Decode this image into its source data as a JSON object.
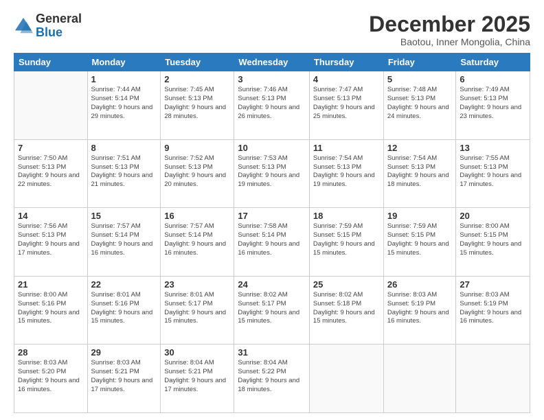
{
  "logo": {
    "general": "General",
    "blue": "Blue"
  },
  "header": {
    "month": "December 2025",
    "location": "Baotou, Inner Mongolia, China"
  },
  "days_of_week": [
    "Sunday",
    "Monday",
    "Tuesday",
    "Wednesday",
    "Thursday",
    "Friday",
    "Saturday"
  ],
  "weeks": [
    [
      {
        "day": "",
        "info": ""
      },
      {
        "day": "1",
        "info": "Sunrise: 7:44 AM\nSunset: 5:14 PM\nDaylight: 9 hours\nand 29 minutes."
      },
      {
        "day": "2",
        "info": "Sunrise: 7:45 AM\nSunset: 5:13 PM\nDaylight: 9 hours\nand 28 minutes."
      },
      {
        "day": "3",
        "info": "Sunrise: 7:46 AM\nSunset: 5:13 PM\nDaylight: 9 hours\nand 26 minutes."
      },
      {
        "day": "4",
        "info": "Sunrise: 7:47 AM\nSunset: 5:13 PM\nDaylight: 9 hours\nand 25 minutes."
      },
      {
        "day": "5",
        "info": "Sunrise: 7:48 AM\nSunset: 5:13 PM\nDaylight: 9 hours\nand 24 minutes."
      },
      {
        "day": "6",
        "info": "Sunrise: 7:49 AM\nSunset: 5:13 PM\nDaylight: 9 hours\nand 23 minutes."
      }
    ],
    [
      {
        "day": "7",
        "info": "Sunrise: 7:50 AM\nSunset: 5:13 PM\nDaylight: 9 hours\nand 22 minutes."
      },
      {
        "day": "8",
        "info": "Sunrise: 7:51 AM\nSunset: 5:13 PM\nDaylight: 9 hours\nand 21 minutes."
      },
      {
        "day": "9",
        "info": "Sunrise: 7:52 AM\nSunset: 5:13 PM\nDaylight: 9 hours\nand 20 minutes."
      },
      {
        "day": "10",
        "info": "Sunrise: 7:53 AM\nSunset: 5:13 PM\nDaylight: 9 hours\nand 19 minutes."
      },
      {
        "day": "11",
        "info": "Sunrise: 7:54 AM\nSunset: 5:13 PM\nDaylight: 9 hours\nand 19 minutes."
      },
      {
        "day": "12",
        "info": "Sunrise: 7:54 AM\nSunset: 5:13 PM\nDaylight: 9 hours\nand 18 minutes."
      },
      {
        "day": "13",
        "info": "Sunrise: 7:55 AM\nSunset: 5:13 PM\nDaylight: 9 hours\nand 17 minutes."
      }
    ],
    [
      {
        "day": "14",
        "info": "Sunrise: 7:56 AM\nSunset: 5:13 PM\nDaylight: 9 hours\nand 17 minutes."
      },
      {
        "day": "15",
        "info": "Sunrise: 7:57 AM\nSunset: 5:14 PM\nDaylight: 9 hours\nand 16 minutes."
      },
      {
        "day": "16",
        "info": "Sunrise: 7:57 AM\nSunset: 5:14 PM\nDaylight: 9 hours\nand 16 minutes."
      },
      {
        "day": "17",
        "info": "Sunrise: 7:58 AM\nSunset: 5:14 PM\nDaylight: 9 hours\nand 16 minutes."
      },
      {
        "day": "18",
        "info": "Sunrise: 7:59 AM\nSunset: 5:15 PM\nDaylight: 9 hours\nand 15 minutes."
      },
      {
        "day": "19",
        "info": "Sunrise: 7:59 AM\nSunset: 5:15 PM\nDaylight: 9 hours\nand 15 minutes."
      },
      {
        "day": "20",
        "info": "Sunrise: 8:00 AM\nSunset: 5:15 PM\nDaylight: 9 hours\nand 15 minutes."
      }
    ],
    [
      {
        "day": "21",
        "info": "Sunrise: 8:00 AM\nSunset: 5:16 PM\nDaylight: 9 hours\nand 15 minutes."
      },
      {
        "day": "22",
        "info": "Sunrise: 8:01 AM\nSunset: 5:16 PM\nDaylight: 9 hours\nand 15 minutes."
      },
      {
        "day": "23",
        "info": "Sunrise: 8:01 AM\nSunset: 5:17 PM\nDaylight: 9 hours\nand 15 minutes."
      },
      {
        "day": "24",
        "info": "Sunrise: 8:02 AM\nSunset: 5:17 PM\nDaylight: 9 hours\nand 15 minutes."
      },
      {
        "day": "25",
        "info": "Sunrise: 8:02 AM\nSunset: 5:18 PM\nDaylight: 9 hours\nand 15 minutes."
      },
      {
        "day": "26",
        "info": "Sunrise: 8:03 AM\nSunset: 5:19 PM\nDaylight: 9 hours\nand 16 minutes."
      },
      {
        "day": "27",
        "info": "Sunrise: 8:03 AM\nSunset: 5:19 PM\nDaylight: 9 hours\nand 16 minutes."
      }
    ],
    [
      {
        "day": "28",
        "info": "Sunrise: 8:03 AM\nSunset: 5:20 PM\nDaylight: 9 hours\nand 16 minutes."
      },
      {
        "day": "29",
        "info": "Sunrise: 8:03 AM\nSunset: 5:21 PM\nDaylight: 9 hours\nand 17 minutes."
      },
      {
        "day": "30",
        "info": "Sunrise: 8:04 AM\nSunset: 5:21 PM\nDaylight: 9 hours\nand 17 minutes."
      },
      {
        "day": "31",
        "info": "Sunrise: 8:04 AM\nSunset: 5:22 PM\nDaylight: 9 hours\nand 18 minutes."
      },
      {
        "day": "",
        "info": ""
      },
      {
        "day": "",
        "info": ""
      },
      {
        "day": "",
        "info": ""
      }
    ]
  ]
}
